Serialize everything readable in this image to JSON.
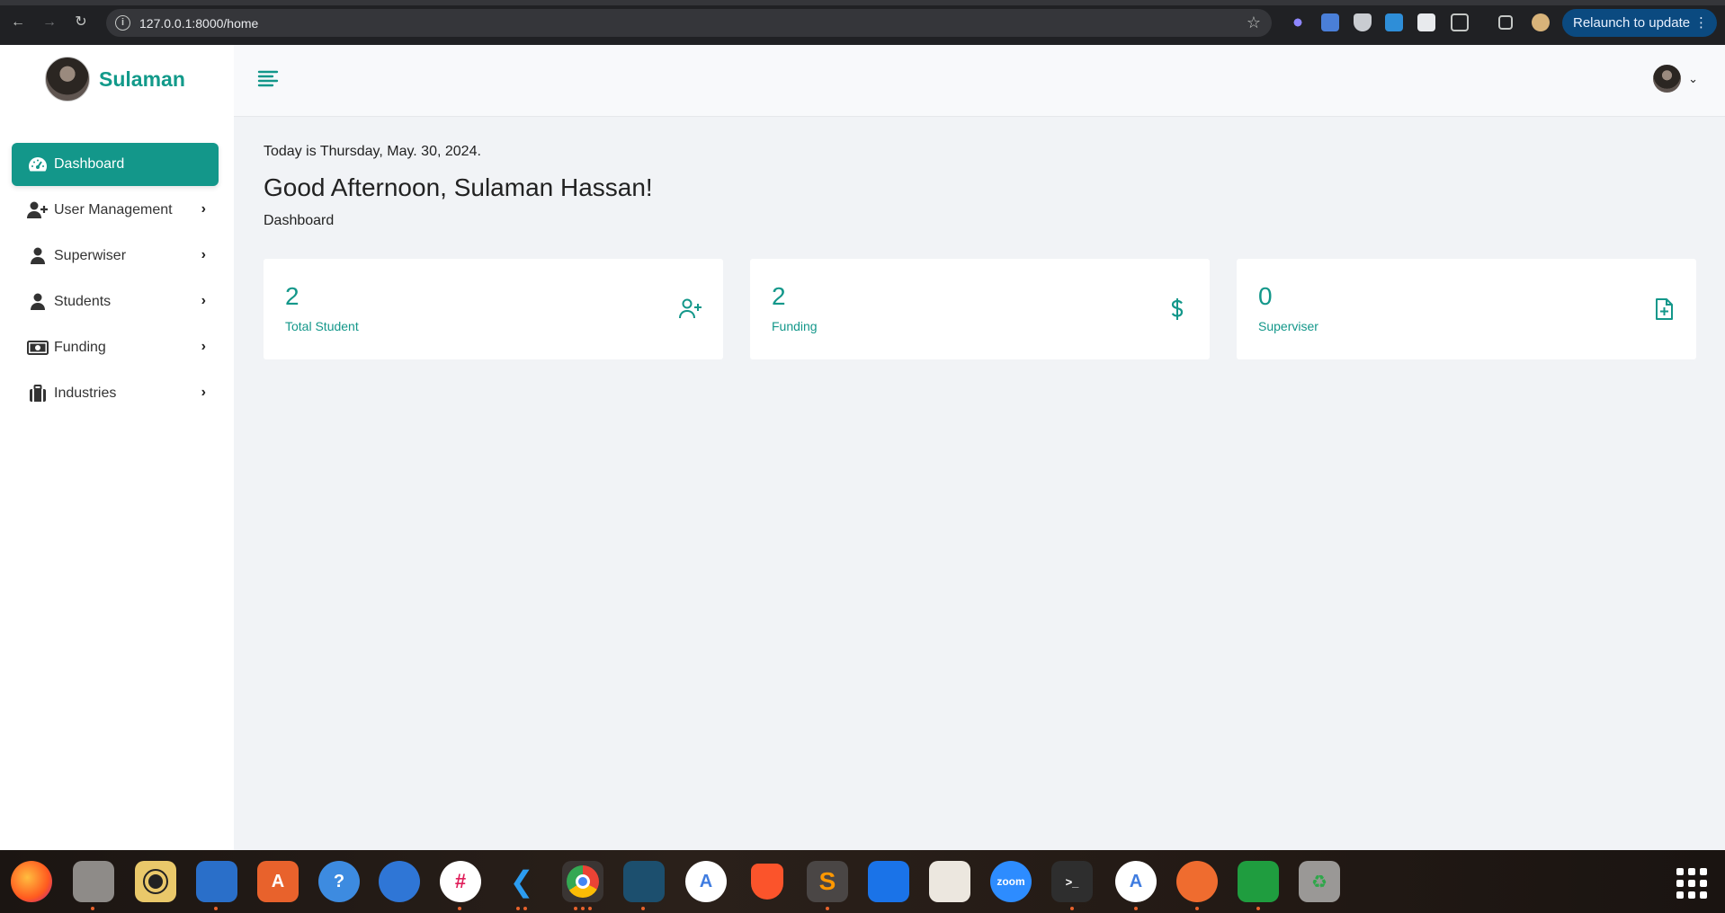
{
  "browser": {
    "url": "127.0.0.1:8000/home",
    "relaunch_label": "Relaunch to update"
  },
  "sidebar": {
    "brand_name": "Sulaman",
    "items": [
      {
        "label": "Dashboard",
        "icon": "gauge-icon",
        "active": true
      },
      {
        "label": "User Management",
        "icon": "user-plus-icon"
      },
      {
        "label": "Superwiser",
        "icon": "user-icon"
      },
      {
        "label": "Students",
        "icon": "user-icon"
      },
      {
        "label": "Funding",
        "icon": "money-bill-icon"
      },
      {
        "label": "Industries",
        "icon": "briefcase-icon"
      }
    ]
  },
  "main": {
    "date_text": "Today is Thursday, May. 30, 2024.",
    "greeting": "Good Afternoon, Sulaman Hassan!",
    "breadcrumb": "Dashboard",
    "cards": [
      {
        "value": "2",
        "label": "Total Student",
        "icon": "user-plus-icon"
      },
      {
        "value": "2",
        "label": "Funding",
        "icon": "dollar-icon"
      },
      {
        "value": "0",
        "label": "Superviser",
        "icon": "file-plus-icon"
      }
    ]
  },
  "colors": {
    "accent": "#13978a",
    "chrome": "#202124",
    "page_bg": "#f1f3f6"
  },
  "dock": {
    "apps": [
      "firefox-icon",
      "files-icon",
      "rhythmbox-icon",
      "libreoffice-writer-icon",
      "app-center-icon",
      "help-icon",
      "thunderbird-icon",
      "slack-icon",
      "vscode-icon",
      "chrome-icon",
      "mysql-workbench-icon",
      "android-studio-icon",
      "brave-icon",
      "sublime-text-icon",
      "trello-icon",
      "document-viewer-icon",
      "zoom-icon",
      "terminal-icon",
      "software-updater-icon",
      "postman-icon",
      "libreoffice-calc-icon",
      "trash-icon"
    ]
  }
}
